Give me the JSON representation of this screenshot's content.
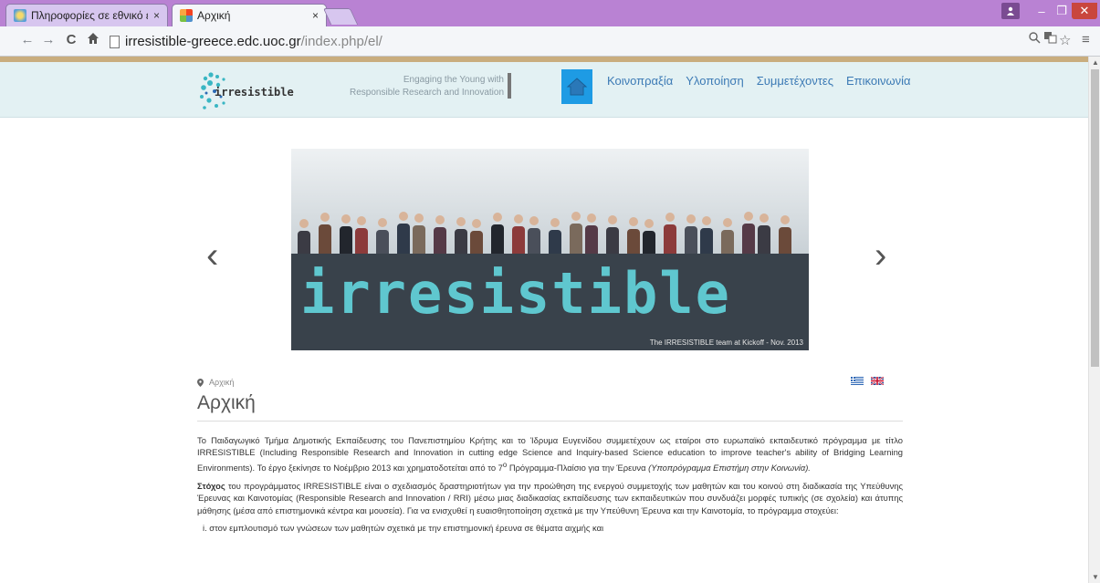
{
  "browser": {
    "tabs": [
      {
        "title": "Πληροφορίες σε εθνικό ε",
        "close": "×"
      },
      {
        "title": "Αρχική",
        "close": "×"
      }
    ],
    "url_host": "irresistible-greece.edc.uoc.gr",
    "url_path": "/index.php/el/",
    "window": {
      "minimize": "–",
      "maximize": "❐",
      "close": "✕"
    }
  },
  "site": {
    "logo_text": "irresistible",
    "tagline_line1": "Engaging the Young with",
    "tagline_line2": "Responsible Research and Innovation",
    "menu": [
      "Κοινοπραξία",
      "Υλοποίηση",
      "Συμμετέχοντες",
      "Επικοινωνία"
    ]
  },
  "slider": {
    "banner_text": "irresistible",
    "caption": "The IRRESISTIBLE team at Kickoff - Nov. 2013",
    "prev": "‹",
    "next": "›"
  },
  "content": {
    "breadcrumb": "Αρχική",
    "title": "Αρχική",
    "para1_a": "Το Παιδαγωγικό Τμήμα Δημοτικής Εκπαίδευσης του Πανεπιστημίου Κρήτης και το Ίδρυμα Ευγενίδου συμμετέχουν ως εταίροι στο ευρωπαϊκό εκπαιδευτικό πρόγραμμα με τίτλο IRRESISTIBLE (Including Responsible Research and Innovation in cutting edge Science and Inquiry-based Science education to improve teacher's ability of Bridging Learning Environments). Το έργο ξεκίνησε το Νοέμβριο 2013 και χρηματοδοτείται από το 7",
    "para1_sup": "ο",
    "para1_b": " Πρόγραμμα-Πλαίσιο για την Έρευνα ",
    "para1_em": "(Υποπρόγραμμα Επιστήμη στην Κοινωνία).",
    "para2_strong": "Στόχος",
    "para2": " του προγράμματος IRRESISTIBLE είναι ο σχεδιασμός δραστηριοτήτων για την προώθηση της ενεργού συμμετοχής των μαθητών και του κοινού στη διαδικασία της Υπεύθυνης Έρευνας και Καινοτομίας (Responsible Research and Innovation / RRI) μέσω μιας διαδικασίας εκπαίδευσης των εκπαιδευτικών που συνδυάζει μορφές τυπικής (σε σχολεία) και άτυπης μάθησης (μέσα από επιστημονικά κέντρα και μουσεία). Για να ενισχυθεί η ευαισθητοποίηση σχετικά με την Υπεύθυνη Έρευνα και την Καινοτομία, το πρόγραμμα στοχεύει:",
    "list_item_1": "i.   στον εμπλουτισμό των γνώσεων των μαθητών σχετικά με την επιστημονική έρευνα σε θέματα αιχμής και"
  }
}
